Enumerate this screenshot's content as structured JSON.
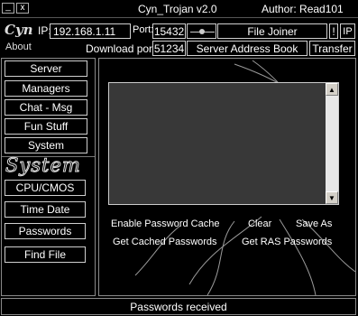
{
  "titlebar": {
    "title": "Cyn_Trojan v2.0",
    "author": "Author: Read101",
    "minimize": "_",
    "close": "x"
  },
  "logo": {
    "brand": "Cyn",
    "about": "About"
  },
  "connection": {
    "ip_label": "IP:",
    "ip_value": "192.168.1.11",
    "port_label": "Port:",
    "port_value": "15432",
    "download_port_label": "Download port:",
    "download_port_value": "51234",
    "file_joiner": "File Joiner",
    "exclaim": "!",
    "ip_button": "IP",
    "server_address_book": "Server Address Book",
    "transfer": "Transfer"
  },
  "sidebar": {
    "top_items": [
      "Server",
      "Managers",
      "Chat - Msg",
      "Fun Stuff",
      "System"
    ],
    "section_title": "System",
    "sub_items": [
      "CPU/CMOS",
      "Time Date",
      "Passwords",
      "Find File"
    ]
  },
  "passwords_panel": {
    "enable_password_cache": "Enable Password Cache",
    "clear": "Clear",
    "save_as": "Save As",
    "get_cached_passwords": "Get Cached Passwords",
    "get_ras_passwords": "Get RAS  Passwords"
  },
  "status": {
    "text": "Passwords received"
  }
}
